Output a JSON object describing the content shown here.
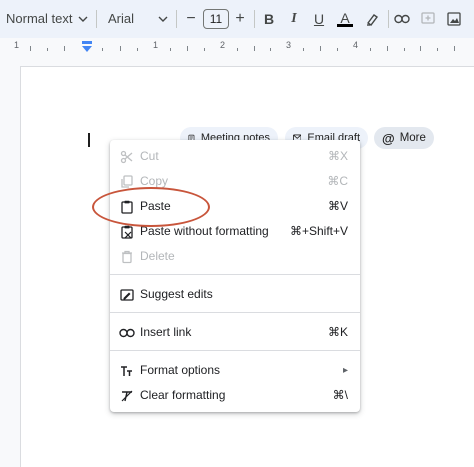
{
  "toolbar": {
    "style_label": "Normal text",
    "font_label": "Arial",
    "font_size": "11",
    "minus": "−",
    "plus": "+",
    "bold": "B",
    "italic": "I",
    "underline": "U",
    "text_color": "A"
  },
  "ruler": {
    "numbers": [
      "1",
      "1",
      "2",
      "3",
      "4"
    ]
  },
  "chips": {
    "meeting_notes": "Meeting notes",
    "email_draft": "Email draft",
    "more": "More"
  },
  "menu": {
    "cut": {
      "label": "Cut",
      "shortcut": "⌘X"
    },
    "copy": {
      "label": "Copy",
      "shortcut": "⌘C"
    },
    "paste": {
      "label": "Paste",
      "shortcut": "⌘V"
    },
    "paste_plain": {
      "label": "Paste without formatting",
      "shortcut": "⌘+Shift+V"
    },
    "delete": {
      "label": "Delete"
    },
    "suggest": {
      "label": "Suggest edits"
    },
    "insert_link": {
      "label": "Insert link",
      "shortcut": "⌘K"
    },
    "format_options": {
      "label": "Format options",
      "shortcut": "▸"
    },
    "clear_formatting": {
      "label": "Clear formatting",
      "shortcut": "⌘\\"
    }
  },
  "colors": {
    "toolbar_bg": "#edf2fa",
    "highlight_ring": "#c8553b",
    "ruler_marker": "#4285f4"
  }
}
